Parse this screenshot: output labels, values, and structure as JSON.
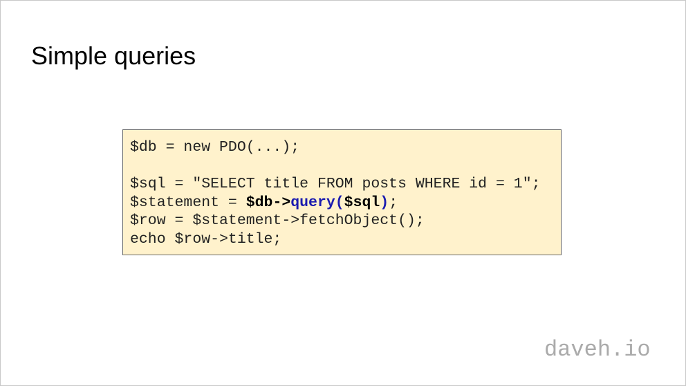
{
  "slide": {
    "title": "Simple queries",
    "code": {
      "line1": "$db = new PDO(...);",
      "line3": "$sql = \"SELECT title FROM posts WHERE id = 1\";",
      "line4": {
        "prefix": "$statement = ",
        "obj": "$db->",
        "method": "query(",
        "arg": "$sql",
        "close": ")",
        "end": ";"
      },
      "line5": "$row = $statement->fetchObject();",
      "line6": "echo $row->title;"
    },
    "brand": "daveh.io",
    "colors": {
      "code_bg": "#fff2cc",
      "highlight": "#1c1cb0",
      "brand": "#aaaaaa"
    }
  }
}
